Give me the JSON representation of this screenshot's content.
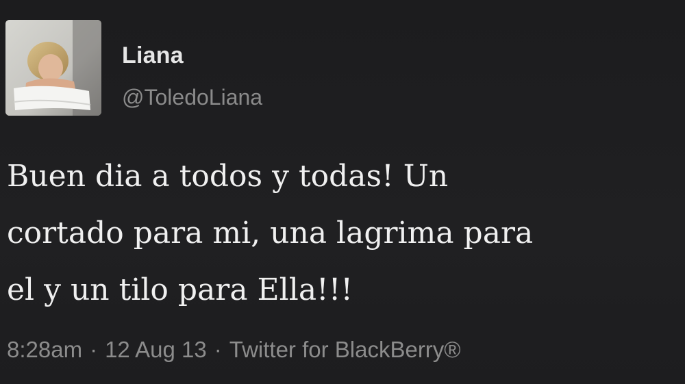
{
  "user": {
    "name": "Liana",
    "handle": "@ToledoLiana",
    "avatar_icon": "profile-photo"
  },
  "tweet": {
    "lines": [
      "Buen dia a todos y todas! Un",
      "cortado para mi, una lagrima para",
      "el y un tilo para Ella!!!"
    ]
  },
  "meta": {
    "time": "8:28am",
    "separator": "·",
    "date": "12 Aug 13",
    "source": "Twitter for BlackBerry®"
  },
  "colors": {
    "background": "#1e1e20",
    "name": "#e6e6e6",
    "secondary": "#8b8b8b",
    "text": "#f0f0f0"
  }
}
